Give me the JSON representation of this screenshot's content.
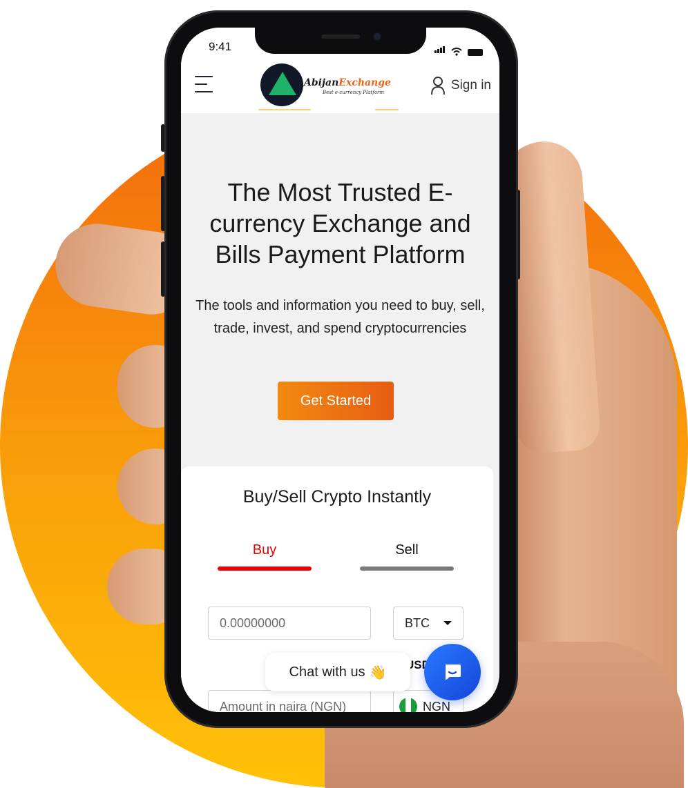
{
  "status_bar": {
    "time": "9:41"
  },
  "header": {
    "brand_name_part1": "Abijan",
    "brand_name_part2": "Exchange",
    "brand_tagline": "Best e-currency Platform",
    "signin_label": "Sign in",
    "icons": {
      "menu": "hamburger-menu-icon",
      "user": "user-icon"
    }
  },
  "hero": {
    "title": "The Most Trusted E-currency Exchange and Bills Payment Platform",
    "subtitle": "The tools and information you need to buy, sell, trade, invest, and spend cryptocurrencies",
    "cta_label": "Get Started"
  },
  "trade_card": {
    "title": "Buy/Sell Crypto Instantly",
    "tabs": [
      {
        "label": "Buy",
        "active": true
      },
      {
        "label": "Sell",
        "active": false
      }
    ],
    "crypto_amount_placeholder": "0.00000000",
    "crypto_currency_selected": "BTC",
    "rate_label_partial": "USD",
    "naira_amount_placeholder": "Amount in naira (NGN)",
    "fiat_currency_selected": "NGN"
  },
  "chat": {
    "label": "Chat with us",
    "emoji": "👋",
    "icon": "chat-icon"
  },
  "colors": {
    "accent_orange": "#f28a10",
    "buy_red": "#f00000",
    "chat_blue": "#2979ff",
    "background_circle": "#f36a0c"
  }
}
